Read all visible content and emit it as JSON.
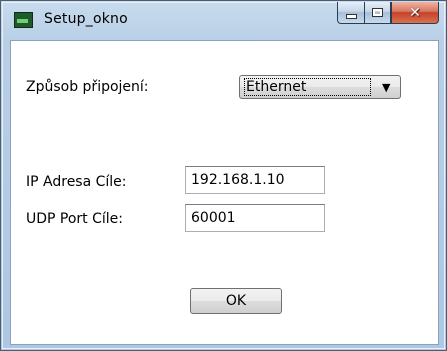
{
  "window": {
    "title": "Setup_okno",
    "icon": "app-window-icon",
    "caption_buttons": {
      "minimize": "minimize-icon",
      "maximize": "maximize-icon",
      "close": "close-icon"
    }
  },
  "form": {
    "connection_label": "Způsob připojení:",
    "connection_value": "Ethernet",
    "ip_label": "IP Adresa Cíle:",
    "ip_value": "192.168.1.10",
    "port_label": "UDP Port Cíle:",
    "port_value": "60001",
    "ok_label": "OK"
  },
  "colors": {
    "frame": "#b8cfe6",
    "close_button": "#c5412a",
    "client_background": "#ffffff"
  }
}
